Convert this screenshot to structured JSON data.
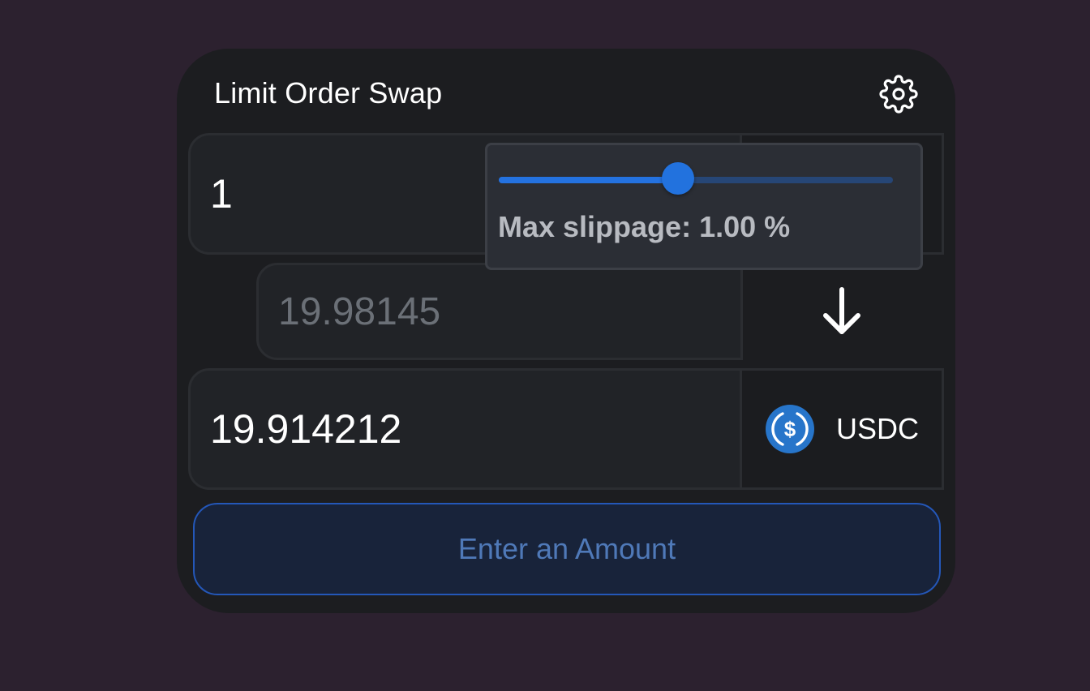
{
  "header": {
    "title": "Limit Order Swap",
    "settings_icon": "gear-icon"
  },
  "swap": {
    "input_amount": "1",
    "rate_placeholder": "19.98145",
    "output_amount": "19.914212",
    "output_token": {
      "symbol": "USDC",
      "icon": "usdc-logo-icon",
      "color": "#2775ca"
    },
    "direction_icon": "arrow-down-icon"
  },
  "slippage": {
    "label": "Max slippage: 1.00 %",
    "slider_fraction": 0.455
  },
  "cta": {
    "label": "Enter an Amount"
  },
  "colors": {
    "background": "#2c212f",
    "card": "#1c1d20",
    "accent": "#2472e0",
    "cta_border": "#2457b8"
  }
}
